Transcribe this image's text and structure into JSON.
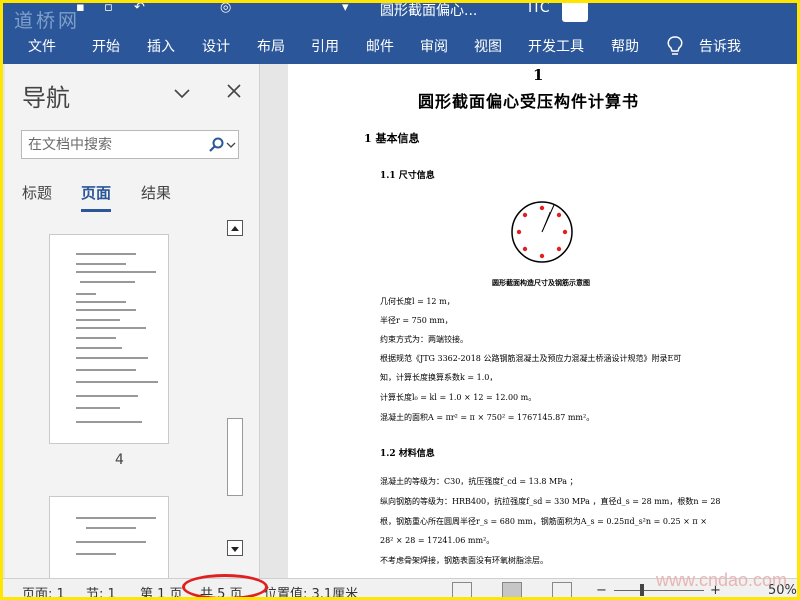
{
  "titlebar": {
    "watermark_left": "道桥网",
    "doc_title": "圆形截面偏心...",
    "user": "ITC"
  },
  "ribbon": {
    "tabs": [
      "文件",
      "开始",
      "插入",
      "设计",
      "布局",
      "引用",
      "邮件",
      "审阅",
      "视图",
      "开发工具",
      "帮助",
      "告诉我"
    ]
  },
  "nav": {
    "title": "导航",
    "search_placeholder": "在文档中搜索",
    "tabs": [
      "标题",
      "页面",
      "结果"
    ],
    "active_tab": "页面",
    "thumb_page_label": "4"
  },
  "document": {
    "page_number": "1",
    "title": "圆形截面偏心受压构件计算书",
    "section1": "1   基本信息",
    "section1_1": "1.1  尺寸信息",
    "caption": "圆形截面构造尺寸及钢筋示意图",
    "lines1": [
      "几何长度l = 12 m，",
      "半径r = 750 mm，",
      "约束方式为：两端铰接。",
      "根据规范《JTG 3362-2018 公路钢筋混凝土及预应力混凝土桥涵设计规范》附录E可",
      "知，计算长度换算系数k = 1.0，",
      "计算长度l₀ = kl = 1.0 × 12 = 12.00 m。",
      "混凝土的面积A = πr² = π × 750² = 1767145.87 mm²。"
    ],
    "section1_2": "1.2  材料信息",
    "lines2": [
      "混凝土的等级为：C30，抗压强度f_cd = 13.8 MPa ；",
      "纵向钢筋的等级为：HRB400，抗拉强度f_sd = 330 MPa ，直径d_s = 28 mm，根数n = 28",
      "根，钢筋重心所在圆周半径r_s = 680 mm，钢筋面积为A_s = 0.25πd_s²n = 0.25 × π ×",
      "28² × 28 = 17241.06 mm²。",
      "不考虑骨架焊接，钢筋表面没有环氧树脂涂层。"
    ]
  },
  "statusbar": {
    "page": "页面: 1",
    "section": "节: 1",
    "page_of": "第 1 页",
    "total": "共 5 页",
    "position": "位置值: 3.1厘米",
    "zoom": "50%",
    "watermark": "www.cndao.com"
  },
  "colors": {
    "ribbon": "#2b579a",
    "highlight_oval": "#e02020",
    "frame": "#ffe600",
    "rebar": "#e02020"
  }
}
